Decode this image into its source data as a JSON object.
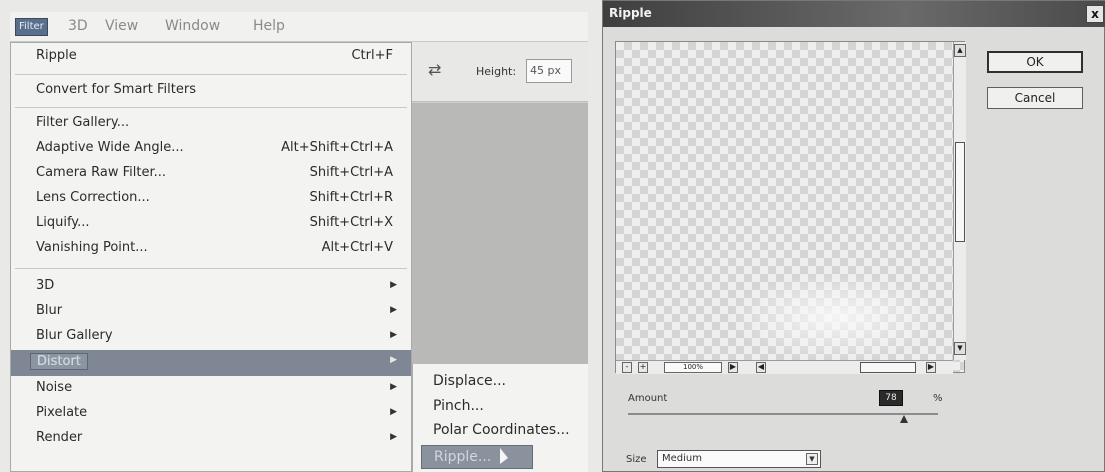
{
  "menubar": {
    "items": [
      "Filter",
      "3D",
      "View",
      "Window",
      "Help"
    ]
  },
  "options": {
    "swap_icon": "swap-arrows-icon",
    "height_label": "Height:",
    "height_value": "45 px"
  },
  "filter_menu": {
    "items": [
      {
        "label": "Ripple",
        "shortcut": "Ctrl+F"
      },
      {
        "label": "Convert for Smart Filters",
        "shortcut": ""
      },
      {
        "label": "Filter Gallery...",
        "shortcut": ""
      },
      {
        "label": "Adaptive Wide Angle...",
        "shortcut": "Alt+Shift+Ctrl+A"
      },
      {
        "label": "Camera Raw Filter...",
        "shortcut": "Shift+Ctrl+A"
      },
      {
        "label": "Lens Correction...",
        "shortcut": "Shift+Ctrl+R"
      },
      {
        "label": "Liquify...",
        "shortcut": "Shift+Ctrl+X"
      },
      {
        "label": "Vanishing Point...",
        "shortcut": "Alt+Ctrl+V"
      },
      {
        "label": "3D",
        "shortcut": ""
      },
      {
        "label": "Blur",
        "shortcut": ""
      },
      {
        "label": "Blur Gallery",
        "shortcut": ""
      },
      {
        "label": "Distort",
        "shortcut": ""
      },
      {
        "label": "Noise",
        "shortcut": ""
      },
      {
        "label": "Pixelate",
        "shortcut": ""
      },
      {
        "label": "Render",
        "shortcut": ""
      }
    ]
  },
  "distort_submenu": {
    "items": [
      "Displace...",
      "Pinch...",
      "Polar Coordinates...",
      "Ripple..."
    ]
  },
  "ripple_dialog": {
    "title": "Ripple",
    "close": "x",
    "ok_label": "OK",
    "cancel_label": "Cancel",
    "zoom_level": "100%",
    "zoom_out": "-",
    "zoom_in": "+",
    "amount_label": "Amount",
    "amount_value": "78",
    "amount_unit": "%",
    "amount_slider_fraction": 0.89,
    "size_label": "Size",
    "size_value": "Medium"
  }
}
